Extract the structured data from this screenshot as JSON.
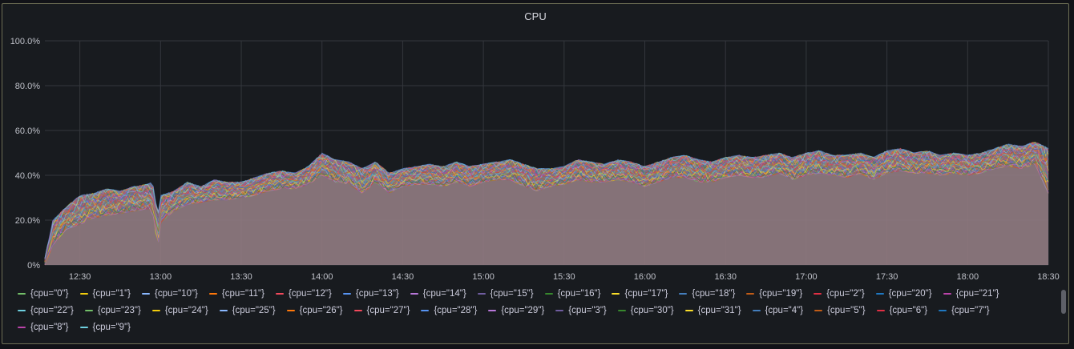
{
  "panel": {
    "title": "CPU"
  },
  "colors": {
    "background": "#181b1f",
    "grid": "#34373d",
    "fill": "#8f7a80",
    "series_palette": [
      "#73bf69",
      "#f2cc0c",
      "#8ab8ff",
      "#ff780a",
      "#f2495c",
      "#5794f2",
      "#b877d9",
      "#705da0",
      "#37872d",
      "#fade2a",
      "#447ebc",
      "#c15c17",
      "#e02f44",
      "#1f78c1",
      "#ba43a9",
      "#6ed0e0"
    ]
  },
  "chart_data": {
    "type": "area",
    "x_ticks": [
      "12:30",
      "13:00",
      "13:30",
      "14:00",
      "14:30",
      "15:00",
      "15:30",
      "16:00",
      "16:30",
      "17:00",
      "17:30",
      "18:00",
      "18:30"
    ],
    "y_ticks": [
      "0%",
      "20.0%",
      "40.0%",
      "60.0%",
      "80.0%",
      "100.0%"
    ],
    "ylim": [
      0,
      100
    ],
    "x_range": [
      "12:17",
      "18:30"
    ],
    "grid": true,
    "legend_position": "bottom",
    "envelope": {
      "times": [
        "12:17",
        "12:20",
        "12:25",
        "12:30",
        "12:35",
        "12:40",
        "12:45",
        "12:50",
        "12:55",
        "12:57",
        "12:59",
        "13:00",
        "13:05",
        "13:10",
        "13:15",
        "13:20",
        "13:25",
        "13:30",
        "13:35",
        "13:40",
        "13:45",
        "13:50",
        "13:55",
        "14:00",
        "14:05",
        "14:10",
        "14:15",
        "14:20",
        "14:25",
        "14:30",
        "14:35",
        "14:40",
        "14:45",
        "14:50",
        "14:55",
        "15:00",
        "15:05",
        "15:10",
        "15:15",
        "15:20",
        "15:25",
        "15:30",
        "15:35",
        "15:40",
        "15:45",
        "15:50",
        "15:55",
        "16:00",
        "16:05",
        "16:10",
        "16:15",
        "16:20",
        "16:25",
        "16:30",
        "16:35",
        "16:40",
        "16:45",
        "16:50",
        "16:55",
        "17:00",
        "17:05",
        "17:10",
        "17:15",
        "17:20",
        "17:25",
        "17:30",
        "17:35",
        "17:40",
        "17:45",
        "17:50",
        "17:55",
        "18:00",
        "18:05",
        "18:10",
        "18:15",
        "18:20",
        "18:25",
        "18:30"
      ],
      "max_pct": [
        3,
        20,
        26,
        31,
        32,
        34,
        33,
        35,
        36,
        37,
        22,
        31,
        33,
        37,
        35,
        38,
        37,
        37,
        39,
        41,
        42,
        41,
        44,
        50,
        47,
        46,
        43,
        46,
        41,
        43,
        44,
        45,
        44,
        46,
        44,
        45,
        46,
        47,
        45,
        43,
        43,
        44,
        47,
        46,
        45,
        47,
        46,
        44,
        46,
        48,
        49,
        47,
        46,
        48,
        49,
        48,
        49,
        50,
        48,
        50,
        51,
        49,
        49,
        50,
        48,
        51,
        52,
        50,
        51,
        49,
        50,
        49,
        50,
        52,
        54,
        53,
        55,
        52
      ],
      "min_pct": [
        0,
        9,
        16,
        18,
        21,
        22,
        23,
        24,
        25,
        24,
        8,
        19,
        24,
        27,
        28,
        29,
        29,
        30,
        31,
        33,
        34,
        34,
        36,
        40,
        37,
        36,
        32,
        37,
        32,
        35,
        36,
        36,
        35,
        37,
        35,
        37,
        38,
        38,
        35,
        33,
        35,
        36,
        38,
        37,
        37,
        38,
        37,
        35,
        37,
        39,
        39,
        37,
        37,
        39,
        40,
        39,
        39,
        41,
        38,
        40,
        41,
        40,
        39,
        41,
        38,
        41,
        42,
        41,
        41,
        40,
        41,
        40,
        41,
        43,
        44,
        43,
        45,
        32
      ]
    },
    "series": [
      {
        "name": "{cpu=\"0\"}"
      },
      {
        "name": "{cpu=\"1\"}"
      },
      {
        "name": "{cpu=\"10\"}"
      },
      {
        "name": "{cpu=\"11\"}"
      },
      {
        "name": "{cpu=\"12\"}"
      },
      {
        "name": "{cpu=\"13\"}"
      },
      {
        "name": "{cpu=\"14\"}"
      },
      {
        "name": "{cpu=\"15\"}"
      },
      {
        "name": "{cpu=\"16\"}"
      },
      {
        "name": "{cpu=\"17\"}"
      },
      {
        "name": "{cpu=\"18\"}"
      },
      {
        "name": "{cpu=\"19\"}"
      },
      {
        "name": "{cpu=\"2\"}"
      },
      {
        "name": "{cpu=\"20\"}"
      },
      {
        "name": "{cpu=\"21\"}"
      },
      {
        "name": "{cpu=\"22\"}"
      },
      {
        "name": "{cpu=\"23\"}"
      },
      {
        "name": "{cpu=\"24\"}"
      },
      {
        "name": "{cpu=\"25\"}"
      },
      {
        "name": "{cpu=\"26\"}"
      },
      {
        "name": "{cpu=\"27\"}"
      },
      {
        "name": "{cpu=\"28\"}"
      },
      {
        "name": "{cpu=\"29\"}"
      },
      {
        "name": "{cpu=\"3\"}"
      },
      {
        "name": "{cpu=\"30\"}"
      },
      {
        "name": "{cpu=\"31\"}"
      },
      {
        "name": "{cpu=\"4\"}"
      },
      {
        "name": "{cpu=\"5\"}"
      },
      {
        "name": "{cpu=\"6\"}"
      },
      {
        "name": "{cpu=\"7\"}"
      },
      {
        "name": "{cpu=\"8\"}"
      },
      {
        "name": "{cpu=\"9\"}"
      }
    ]
  }
}
